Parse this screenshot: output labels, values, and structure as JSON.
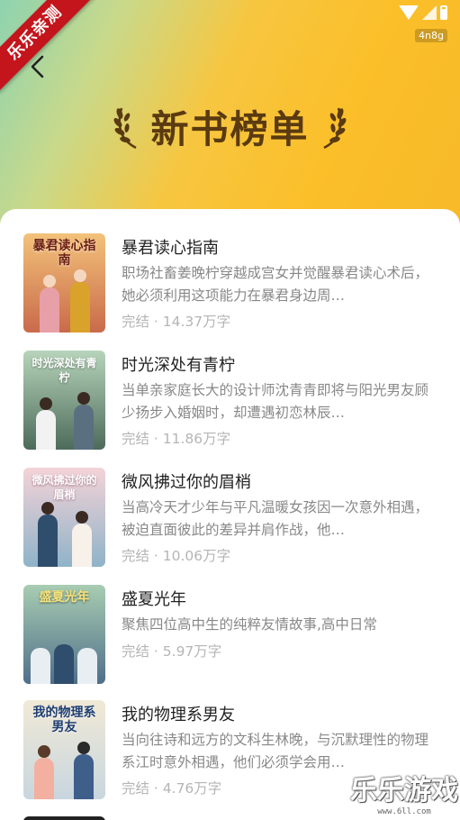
{
  "status_bar": {
    "speed_badge": "4n8g"
  },
  "ribbon": {
    "label": "乐乐亲测"
  },
  "header": {
    "title": "新书榜单"
  },
  "books": [
    {
      "title": "暴君读心指南",
      "description": "职场社畜姜晚柠穿越成宫女并觉醒暴君读心术后，她必须利用这项能力在暴君身边周…",
      "meta": "完结 · 14.37万字",
      "cover_text": "暴君读心指南",
      "cover_colors": [
        "#f3c27a",
        "#c96a4a"
      ]
    },
    {
      "title": "时光深处有青柠",
      "description": "当单亲家庭长大的设计师沈青青即将与阳光男友顾少扬步入婚姻时，却遭遇初恋林辰…",
      "meta": "完结 · 11.86万字",
      "cover_text": "时光深处有青柠",
      "cover_colors": [
        "#9fc2a4",
        "#4d6b5a"
      ]
    },
    {
      "title": "微风拂过你的眉梢",
      "description": "当高冷天才少年与平凡温暖女孩因一次意外相遇，被迫直面彼此的差异并肩作战，他…",
      "meta": "完结 · 10.06万字",
      "cover_text": "微风拂过你的眉梢",
      "cover_colors": [
        "#f4d3d8",
        "#8fb3c8"
      ]
    },
    {
      "title": "盛夏光年",
      "description": "聚焦四位高中生的纯粹友情故事,高中日常",
      "meta": "完结 · 5.97万字",
      "cover_text": "盛夏光年",
      "cover_colors": [
        "#a8cdb2",
        "#4f6f8a"
      ]
    },
    {
      "title": "我的物理系男友",
      "description": "当向往诗和远方的文科生林晚，与沉默理性的物理系江时意外相遇，他们必须学会用…",
      "meta": "完结 · 4.76万字",
      "cover_text": "我的物理系男友",
      "cover_colors": [
        "#f1e9d6",
        "#3e5f8a"
      ]
    }
  ],
  "watermark": {
    "logo": "乐乐游戏",
    "url": "www.6ll.com"
  }
}
